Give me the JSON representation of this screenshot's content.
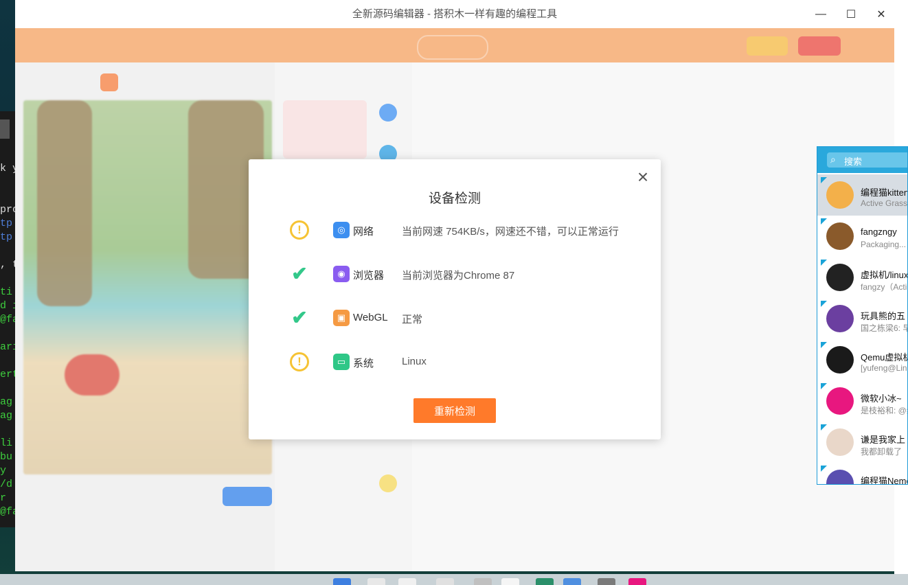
{
  "window": {
    "title": "全新源码编辑器 - 搭积木一样有趣的编程工具",
    "minimize": "—",
    "maximize": "☐",
    "close": "✕"
  },
  "terminal": {
    "lines": [
      "k y",
      "pro",
      "tp",
      "tp",
      ", t",
      "ti",
      "d i",
      "@fa",
      "ari",
      "ert",
      "ag",
      "ag",
      "li",
      "bu",
      " y",
      "/d",
      "r",
      "@fa"
    ]
  },
  "dialog": {
    "title": "设备检测",
    "close_icon": "close-icon",
    "items": [
      {
        "status": "warning",
        "status_glyph": "!",
        "icon": "network-icon",
        "icon_color": "#3d8ff0",
        "label": "网络",
        "value": "当前网速 754KB/s，网速还不错，可以正常运行"
      },
      {
        "status": "ok",
        "status_glyph": "✔",
        "icon": "browser-icon",
        "icon_color": "#8a5cf0",
        "label": "浏览器",
        "value": "当前浏览器为Chrome 87"
      },
      {
        "status": "ok",
        "status_glyph": "✔",
        "icon": "webgl-icon",
        "icon_color": "#f59a43",
        "label": "WebGL",
        "value": "正常"
      },
      {
        "status": "warning",
        "status_glyph": "!",
        "icon": "system-icon",
        "icon_color": "#2fc787",
        "label": "系统",
        "value": "Linux"
      }
    ],
    "recheck_label": "重新检测"
  },
  "qq": {
    "search_placeholder": "搜索",
    "contacts": [
      {
        "name": "编程猫kitten",
        "message": "Active Grass",
        "avatar_color": "#f3b04a",
        "selected": true
      },
      {
        "name": "fangzngy",
        "message": "Packaging...",
        "avatar_color": "#8a5a2b",
        "selected": false
      },
      {
        "name": "虚拟机/linux",
        "message": "fangzy（Acti",
        "avatar_color": "#222222",
        "selected": false
      },
      {
        "name": " 玩具熊的五",
        "message": "国之栋梁6: 早",
        "avatar_color": "#6b3fa0",
        "selected": false
      },
      {
        "name": "Qemu虚拟机",
        "message": "[yufeng@Lin",
        "avatar_color": "#1a1a1a",
        "selected": false
      },
      {
        "name": "微软小冰~",
        "message": "是枝裕和: @编",
        "avatar_color": "#e8177f",
        "selected": false
      },
      {
        "name": "谦是我家上",
        "message": "我都卸载了",
        "avatar_color": "#e9d7c9",
        "selected": false
      },
      {
        "name": "编程猫Nemo",
        "message": "",
        "avatar_color": "#5a4fb0",
        "selected": false
      }
    ]
  },
  "colors": {
    "accent": "#ff7a2a",
    "ok": "#33c88a",
    "warning": "#f6c334",
    "qq_blue": "#2aa8dc"
  }
}
